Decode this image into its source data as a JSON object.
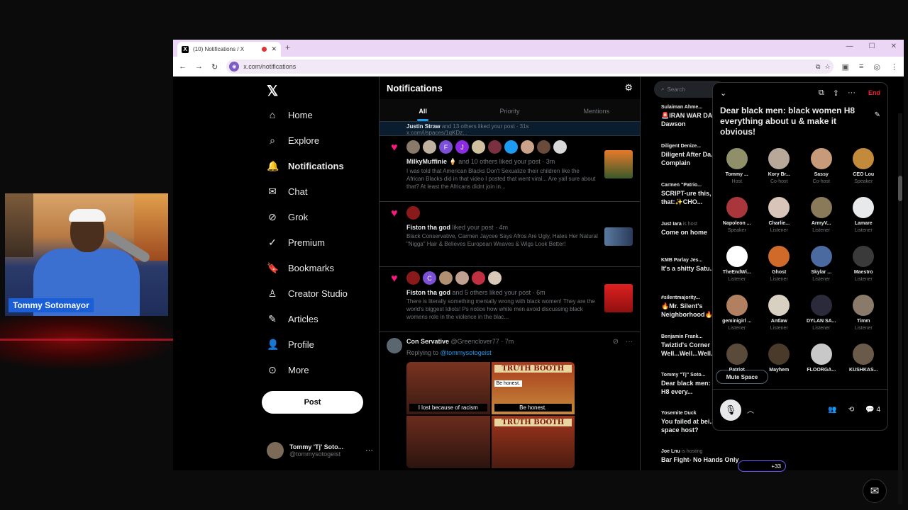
{
  "webcam": {
    "name": "Tommy Sotomayor"
  },
  "browser": {
    "tab_title": "(10) Notifications / X",
    "url": "x.com/notifications"
  },
  "nav": {
    "items": [
      {
        "label": "Home",
        "icon": "home-icon"
      },
      {
        "label": "Explore",
        "icon": "search-icon"
      },
      {
        "label": "Notifications",
        "icon": "bell-icon"
      },
      {
        "label": "Chat",
        "icon": "mail-icon"
      },
      {
        "label": "Grok",
        "icon": "grok-icon"
      },
      {
        "label": "Premium",
        "icon": "check-icon"
      },
      {
        "label": "Bookmarks",
        "icon": "bookmark-icon"
      },
      {
        "label": "Creator Studio",
        "icon": "studio-icon"
      },
      {
        "label": "Articles",
        "icon": "article-icon"
      },
      {
        "label": "Profile",
        "icon": "person-icon"
      },
      {
        "label": "More",
        "icon": "more-icon"
      }
    ],
    "post_label": "Post",
    "user_name": "Tommy 'Tj' Soto...",
    "user_handle": "@tommysotogeist"
  },
  "notifications": {
    "title": "Notifications",
    "tabs": [
      "All",
      "Priority",
      "Mentions"
    ],
    "strip_user": "Justin Straw",
    "strip_text": "and 13 others liked your post · 31s",
    "strip_link": "x.com/i/spaces/1qKDz...",
    "items": [
      {
        "user": "MilkyMuffinie 🍦",
        "action": "and 10 others liked your post · 3m",
        "body": "I was told that American Blacks Don't Sexualize their children like the African Blacks did in that video I posted that went viral... Are yall sure about that? At least the Africans didnt join in..."
      },
      {
        "user": "Fiston tha god",
        "action": "liked your post · 4m",
        "body": "Black Conservative, Carmen Jaycee Says Afros Are Ugly, Hates Her Natural \"Nigga\" Hair & Believes European Weaves & Wigs Look Better!"
      },
      {
        "user": "Fiston tha god",
        "action": "and 5 others liked your post · 6m",
        "body": "There is literally something mentally wrong with black women! They are the world's biggest Idiots! Ps notice how white men avoid discussing black womens role in the violence in the blac..."
      }
    ],
    "reply": {
      "user": "Con Servative",
      "handle": "@Greenclover77 · 7m",
      "replying_prefix": "Replying to",
      "replying_to": "@tommysotogeist",
      "meme_caption": "I lost because of racism",
      "meme_booth": "TRUTH BOOTH",
      "meme_honest": "Be honest.",
      "meme_honest2": "Be honest."
    }
  },
  "right": {
    "search_placeholder": "Search",
    "feed": [
      {
        "user": "Sulaiman Ahme...",
        "text": "🚨IRAN WAR DA... Ryan Dawson"
      },
      {
        "user": "Diligent Denize...",
        "text": "Diligent After Da... Come Complain"
      },
      {
        "user": "Carmen \"Patrio...",
        "text": "SCRIPT-ure this, ure that:✨CHO..."
      },
      {
        "user": "Just Iara",
        "user_note": "is host",
        "text": "Come on home"
      },
      {
        "user": "KMB Parlay Jes...",
        "text": "It's a shitty Satu..."
      },
      {
        "user": "#silentmajority...",
        "text": "🔥Mr. Silent's Neighborhood🔥..."
      },
      {
        "user": "Benjamin Frank...",
        "text": "Twiztid's Corner Well...Well...Well..."
      },
      {
        "user": "Tommy \"Tj\" Soto...",
        "text": "Dear black men: women H8 every..."
      },
      {
        "user": "Yosemite Duck",
        "text": "You failed at bei... twitter space host?"
      },
      {
        "user": "Joe Lnu",
        "user_note": "is hosting",
        "text": "Bar Fight- No Hands Only"
      }
    ],
    "pill_count": "+33"
  },
  "space": {
    "end_label": "End",
    "title": "Dear black men: black women H8 everything about u & make it obvious!",
    "users": [
      {
        "name": "Tommy ...",
        "role": "Host",
        "color": "#8f8f6a"
      },
      {
        "name": "Kory Br...",
        "role": "Co-host",
        "color": "#b8a89a"
      },
      {
        "name": "Sassy",
        "role": "Co-host",
        "color": "#c79b7a"
      },
      {
        "name": "CEO Lou",
        "role": "Speaker",
        "color": "#c28a3a"
      },
      {
        "name": "Napoleon ...",
        "role": "Speaker",
        "color": "#a8363a"
      },
      {
        "name": "Charlie...",
        "role": "Listener",
        "color": "#d8c4b8"
      },
      {
        "name": "ArmyV...",
        "role": "Listener",
        "color": "#8a7a5a"
      },
      {
        "name": "Lamare",
        "role": "Listener",
        "color": "#e7e9ea"
      },
      {
        "name": "TheEndWi...",
        "role": "Listener",
        "color": "#ffffff"
      },
      {
        "name": "Ghost",
        "role": "Listener",
        "color": "#d06a2a"
      },
      {
        "name": "Skylar ...",
        "role": "Listener",
        "color": "#4a6aa0"
      },
      {
        "name": "Maestro",
        "role": "Listener",
        "color": "#3a3a3a"
      },
      {
        "name": "geminigirl ...",
        "role": "Listener",
        "color": "#b08060"
      },
      {
        "name": "Antlaw",
        "role": "Listener",
        "color": "#d8d0c0"
      },
      {
        "name": "DYLAN SA...",
        "role": "Listener",
        "color": "#2a2a3a"
      },
      {
        "name": "Timm",
        "role": "Listener",
        "color": "#8a7a6a"
      },
      {
        "name": "Patriot",
        "role": "",
        "color": "#5a4a3a"
      },
      {
        "name": "Mayhem",
        "role": "",
        "color": "#4a3a2a"
      },
      {
        "name": "FLOORGA...",
        "role": "",
        "color": "#c8c8c8"
      },
      {
        "name": "KUSHKAS...",
        "role": "",
        "color": "#6a5a4a"
      }
    ],
    "mute_label": "Mute Space",
    "comment_count": "4"
  }
}
